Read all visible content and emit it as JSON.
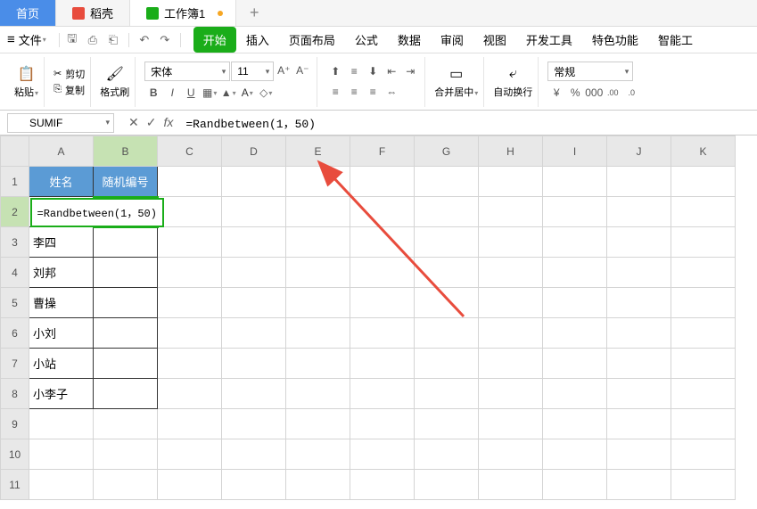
{
  "window_tabs": {
    "home": "首页",
    "daoke": "稻壳",
    "workbook": "工作簿1",
    "add": "+"
  },
  "menu": {
    "hamburger": "≡",
    "file": "文件",
    "tabs": [
      "开始",
      "插入",
      "页面布局",
      "公式",
      "数据",
      "审阅",
      "视图",
      "开发工具",
      "特色功能",
      "智能工"
    ]
  },
  "ribbon": {
    "paste": "粘贴",
    "cut": "剪切",
    "copy": "复制",
    "format_painter": "格式刷",
    "font_family": "宋体",
    "font_size": "11",
    "merge_center": "合并居中",
    "auto_wrap": "自动换行",
    "number_format": "常规",
    "currency": "¥",
    "percent": "%",
    "thousands": "000",
    "dec_inc": ".0→.00",
    "dec_dec": ".00→.0"
  },
  "formula_bar": {
    "name_box": "SUMIF",
    "cancel": "✕",
    "enter": "✓",
    "fx": "fx",
    "formula": "=Randbetween(1，50)"
  },
  "columns": [
    "A",
    "B",
    "C",
    "D",
    "E",
    "F",
    "G",
    "H",
    "I",
    "J",
    "K"
  ],
  "rows": [
    "1",
    "2",
    "3",
    "4",
    "5",
    "6",
    "7",
    "8",
    "9",
    "10",
    "11"
  ],
  "headers": {
    "name": "姓名",
    "randno": "随机编号"
  },
  "cell_editing": "=Randbetween(1，50)",
  "names": [
    "李四",
    "刘邦",
    "曹操",
    "小刘",
    "小站",
    "小李子"
  ]
}
